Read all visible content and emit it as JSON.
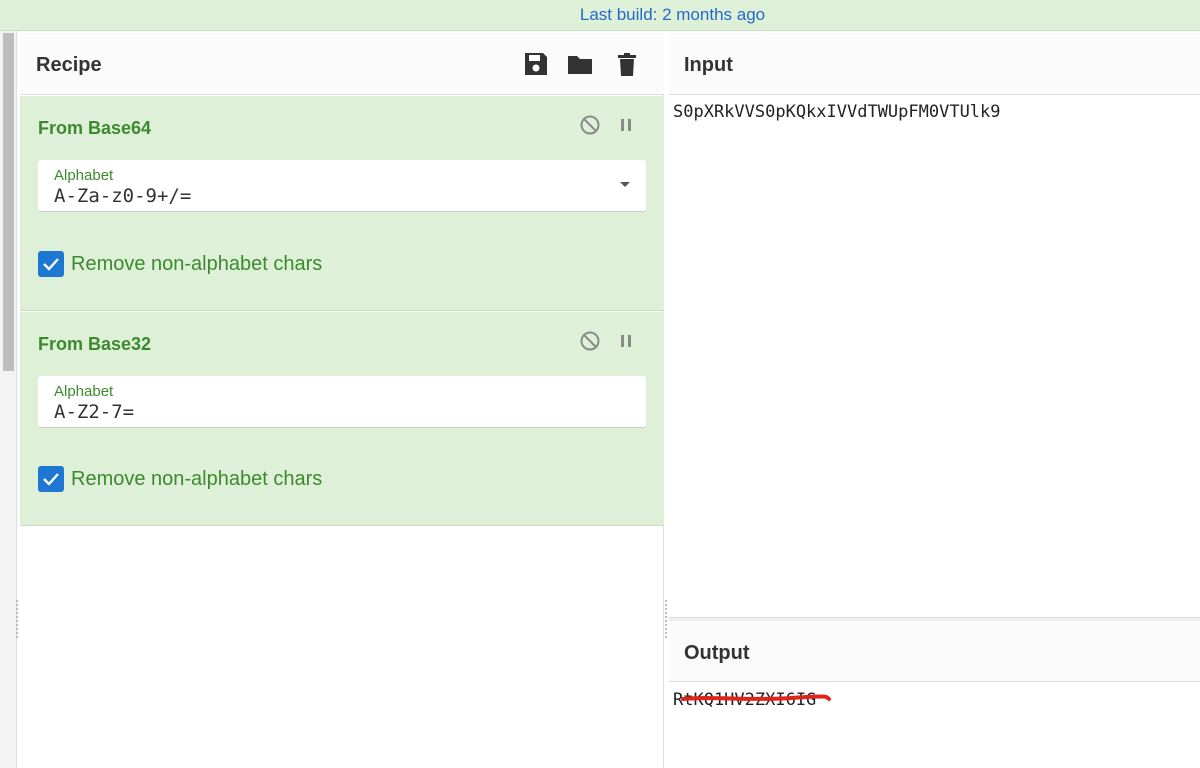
{
  "banner": {
    "text": "Last build: 2 months ago"
  },
  "recipe": {
    "title": "Recipe",
    "operations": [
      {
        "name": "From Base64",
        "alphabet_label": "Alphabet",
        "alphabet_value": "A-Za-z0-9+/=",
        "checkbox_label": "Remove non-alphabet chars",
        "checkbox_checked": true
      },
      {
        "name": "From Base32",
        "alphabet_label": "Alphabet",
        "alphabet_value": "A-Z2-7=",
        "checkbox_label": "Remove non-alphabet chars",
        "checkbox_checked": true
      }
    ]
  },
  "input": {
    "title": "Input",
    "text": "S0pXRkVVS0pKQkxIVVdTWUpFM0VTUlk9"
  },
  "output": {
    "title": "Output",
    "text": "RtKQ1HV2ZXI6IG"
  },
  "icons": {
    "save": "save-icon",
    "open": "folder-icon",
    "clear": "trash-icon",
    "disable": "disable-icon",
    "pause": "pause-icon",
    "dropdown": "chevron-down-icon",
    "check": "check-icon"
  },
  "colors": {
    "banner_bg": "#dff0d8",
    "link_blue": "#2569c8",
    "op_bg": "#dff0d8",
    "op_green": "#3c8a2e",
    "checkbox_blue": "#1e77d2",
    "redaction_red": "#e0241b"
  }
}
